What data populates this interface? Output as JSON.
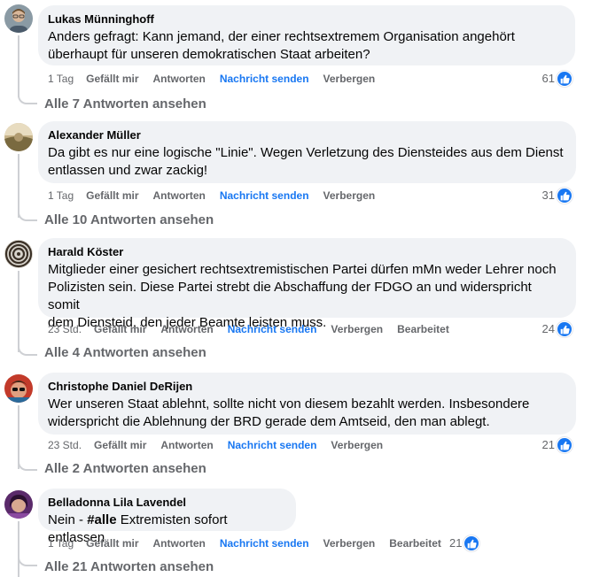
{
  "comments": [
    {
      "author": "Lukas Münninghoff",
      "text_lines": [
        "Anders gefragt: Kann jemand, der einer rechtsextremem Organisation angehört",
        "überhaupt für unseren demokratischen Staat arbeiten?"
      ],
      "time": "1 Tag",
      "like_label": "Gefällt mir",
      "reply_label": "Antworten",
      "message_label": "Nachricht senden",
      "hide_label": "Verbergen",
      "reactions": "61",
      "replies_label": "Alle 7 Antworten ansehen",
      "avatar_icon": "profile-photo"
    },
    {
      "author": "Alexander Müller",
      "text_lines": [
        "Da gibt es nur eine logische \"Linie\". Wegen Verletzung des Diensteides aus dem Dienst",
        "entlassen und zwar zackig!"
      ],
      "time": "1 Tag",
      "like_label": "Gefällt mir",
      "reply_label": "Antworten",
      "message_label": "Nachricht senden",
      "hide_label": "Verbergen",
      "reactions": "31",
      "replies_label": "Alle 10 Antworten ansehen",
      "avatar_icon": "profile-photo"
    },
    {
      "author": "Harald Köster",
      "text_lines": [
        "Mitglieder einer gesichert rechtsextremistischen Partei dürfen mMn weder Lehrer noch",
        "Polizisten sein. Diese Partei strebt die Abschaffung der FDGO an und widerspricht somit",
        "dem Diensteid, den jeder Beamte leisten muss."
      ],
      "time": "23 Std.",
      "like_label": "Gefällt mir",
      "reply_label": "Antworten",
      "message_label": "Nachricht senden",
      "hide_label": "Verbergen",
      "edited_label": "Bearbeitet",
      "reactions": "24",
      "replies_label": "Alle 4 Antworten ansehen",
      "avatar_icon": "profile-photo"
    },
    {
      "author": "Christophe Daniel DeRijen",
      "text_lines": [
        "Wer unseren Staat ablehnt, sollte nicht von diesem bezahlt werden. Insbesondere",
        "widerspricht die Ablehnung der BRD gerade dem Amtseid, den man ablegt."
      ],
      "time": "23 Std.",
      "like_label": "Gefällt mir",
      "reply_label": "Antworten",
      "message_label": "Nachricht senden",
      "hide_label": "Verbergen",
      "reactions": "21",
      "replies_label": "Alle 2 Antworten ansehen",
      "avatar_icon": "profile-photo"
    },
    {
      "author": "Belladonna Lila Lavendel",
      "text_prefix": "Nein - ",
      "text_hashtag": "#alle",
      "text_suffix": " Extremisten sofort entlassen",
      "time": "1 Tag",
      "like_label": "Gefällt mir",
      "reply_label": "Antworten",
      "message_label": "Nachricht senden",
      "hide_label": "Verbergen",
      "edited_label": "Bearbeitet",
      "reactions": "21",
      "replies_label": "Alle 21 Antworten ansehen",
      "avatar_icon": "profile-photo"
    }
  ],
  "colors": {
    "bubble": "#f0f2f5",
    "meta_text": "#65676b",
    "link_blue": "#1877f2",
    "thread_line": "#ced0d4"
  },
  "icons": {
    "like_reaction": "thumbs-up-icon"
  }
}
